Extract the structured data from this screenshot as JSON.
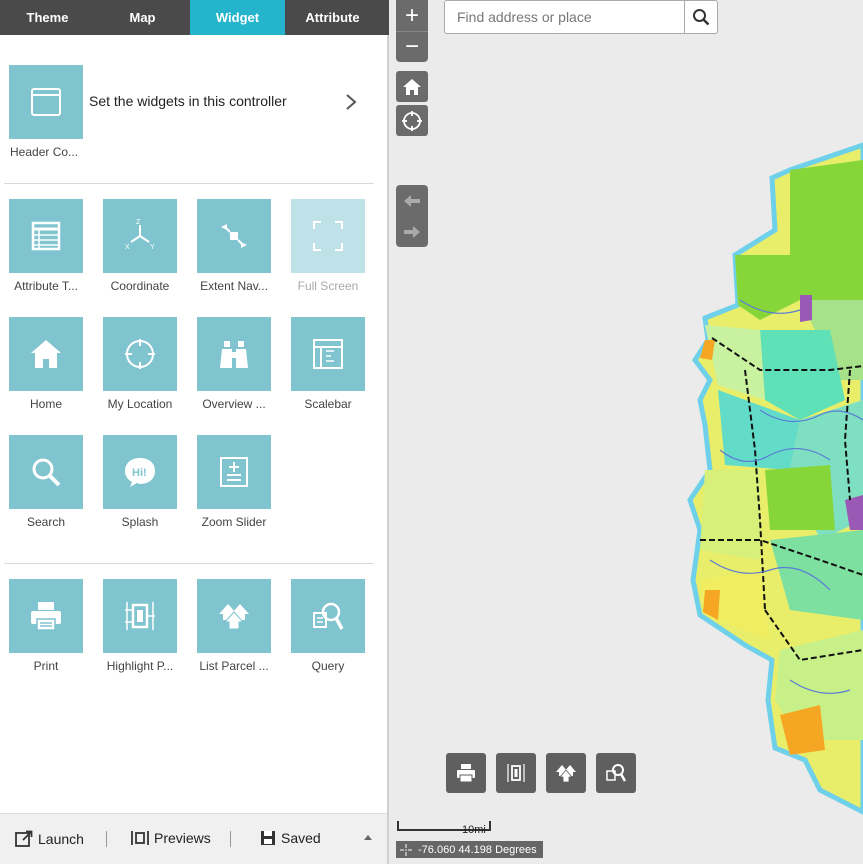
{
  "tabs": [
    {
      "label": "Theme"
    },
    {
      "label": "Map"
    },
    {
      "label": "Widget"
    },
    {
      "label": "Attribute"
    }
  ],
  "header_widget": {
    "label": "Header Co...",
    "description": "Set the widgets in this controller"
  },
  "widgets_row1": [
    {
      "label": "Attribute T...",
      "icon": "table-icon"
    },
    {
      "label": "Coordinate",
      "icon": "xyz-axes-icon"
    },
    {
      "label": "Extent Nav...",
      "icon": "extent-navigate-icon"
    },
    {
      "label": "Full Screen",
      "icon": "fullscreen-icon"
    }
  ],
  "widgets_row2": [
    {
      "label": "Home",
      "icon": "home-icon"
    },
    {
      "label": "My Location",
      "icon": "crosshair-icon"
    },
    {
      "label": "Overview ...",
      "icon": "binoculars-icon"
    },
    {
      "label": "Scalebar",
      "icon": "scalebar-icon"
    }
  ],
  "widgets_row3": [
    {
      "label": "Search",
      "icon": "search-icon"
    },
    {
      "label": "Splash",
      "icon": "speech-bubble-hi-icon"
    },
    {
      "label": "Zoom Slider",
      "icon": "zoom-slider-icon"
    }
  ],
  "widgets_row4": [
    {
      "label": "Print",
      "icon": "printer-icon"
    },
    {
      "label": "Highlight P...",
      "icon": "highlight-parcel-icon"
    },
    {
      "label": "List Parcel ...",
      "icon": "list-parcel-icon"
    },
    {
      "label": "Query",
      "icon": "query-icon"
    }
  ],
  "footer": {
    "launch": "Launch",
    "previews": "Previews",
    "saved": "Saved"
  },
  "map": {
    "search_placeholder": "Find address or place",
    "zoom_in": "+",
    "zoom_out": "−",
    "scale_label": "10mi",
    "coordinates": "-76.060 44.198 Degrees"
  },
  "colors": {
    "tab_bar": "#4a4a4a",
    "tab_active": "#24b5cc",
    "tile": "#7fc4cf",
    "tile_disabled": "#bfe2e8",
    "map_control": "#6b6b6b",
    "boundary": "#6fd0ea"
  }
}
